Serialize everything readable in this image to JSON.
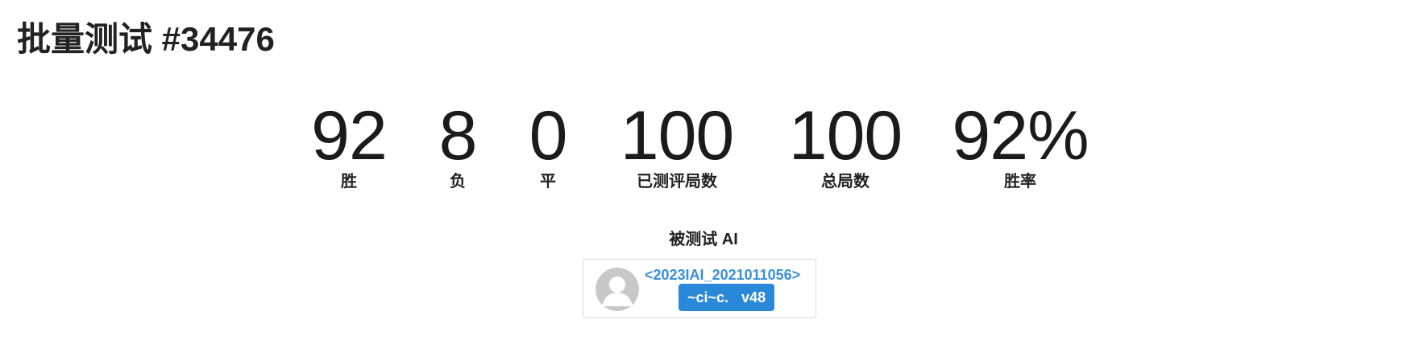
{
  "page": {
    "title": "批量测试 #34476"
  },
  "stats": [
    {
      "value": "92",
      "label": "胜"
    },
    {
      "value": "8",
      "label": "负"
    },
    {
      "value": "0",
      "label": "平"
    },
    {
      "value": "100",
      "label": "已测评局数"
    },
    {
      "value": "100",
      "label": "总局数"
    },
    {
      "value": "92%",
      "label": "胜率"
    }
  ],
  "tested_ai": {
    "heading": "被测试 AI",
    "name": "<2023IAI_2021011056>",
    "author": "~ci~c.",
    "version": "v48",
    "avatar_icon": "default-user-avatar-icon"
  },
  "colors": {
    "link": "#3a8fd9",
    "badge_bg": "#2a88d8",
    "badge_text": "#ffffff",
    "avatar_bg": "#c8c8c8"
  }
}
